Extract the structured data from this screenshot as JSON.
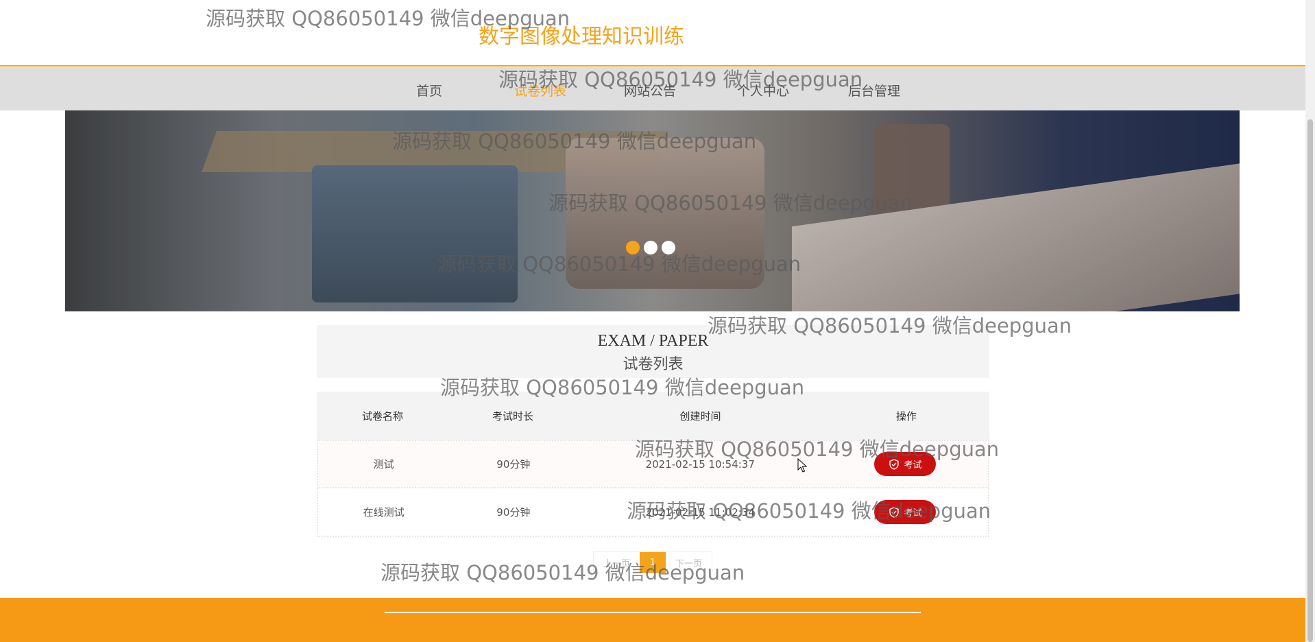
{
  "site": {
    "title": "数字图像处理知识训练"
  },
  "nav": {
    "items": [
      {
        "label": "首页"
      },
      {
        "label": "试卷列表"
      },
      {
        "label": "网站公告"
      },
      {
        "label": "个人中心"
      },
      {
        "label": "后台管理"
      }
    ]
  },
  "section": {
    "en_title": "EXAM / PAPER",
    "cn_title": "试卷列表"
  },
  "table": {
    "headers": [
      "试卷名称",
      "考试时长",
      "创建时间",
      "操作"
    ],
    "rows": [
      {
        "name": "测试",
        "duration": "90分钟",
        "created": "2021-02-15 10:54:37",
        "action": "考试"
      },
      {
        "name": "在线测试",
        "duration": "90分钟",
        "created": "2021-02-15 11:02:34",
        "action": "考试"
      }
    ]
  },
  "pagination": {
    "prev": "上一页",
    "current": "1",
    "next": "下一页"
  },
  "watermark": "源码获取 QQ86050149 微信deepguan",
  "colors": {
    "accent": "#f5a31a",
    "danger": "#cc1010",
    "footer": "#f69a15"
  }
}
